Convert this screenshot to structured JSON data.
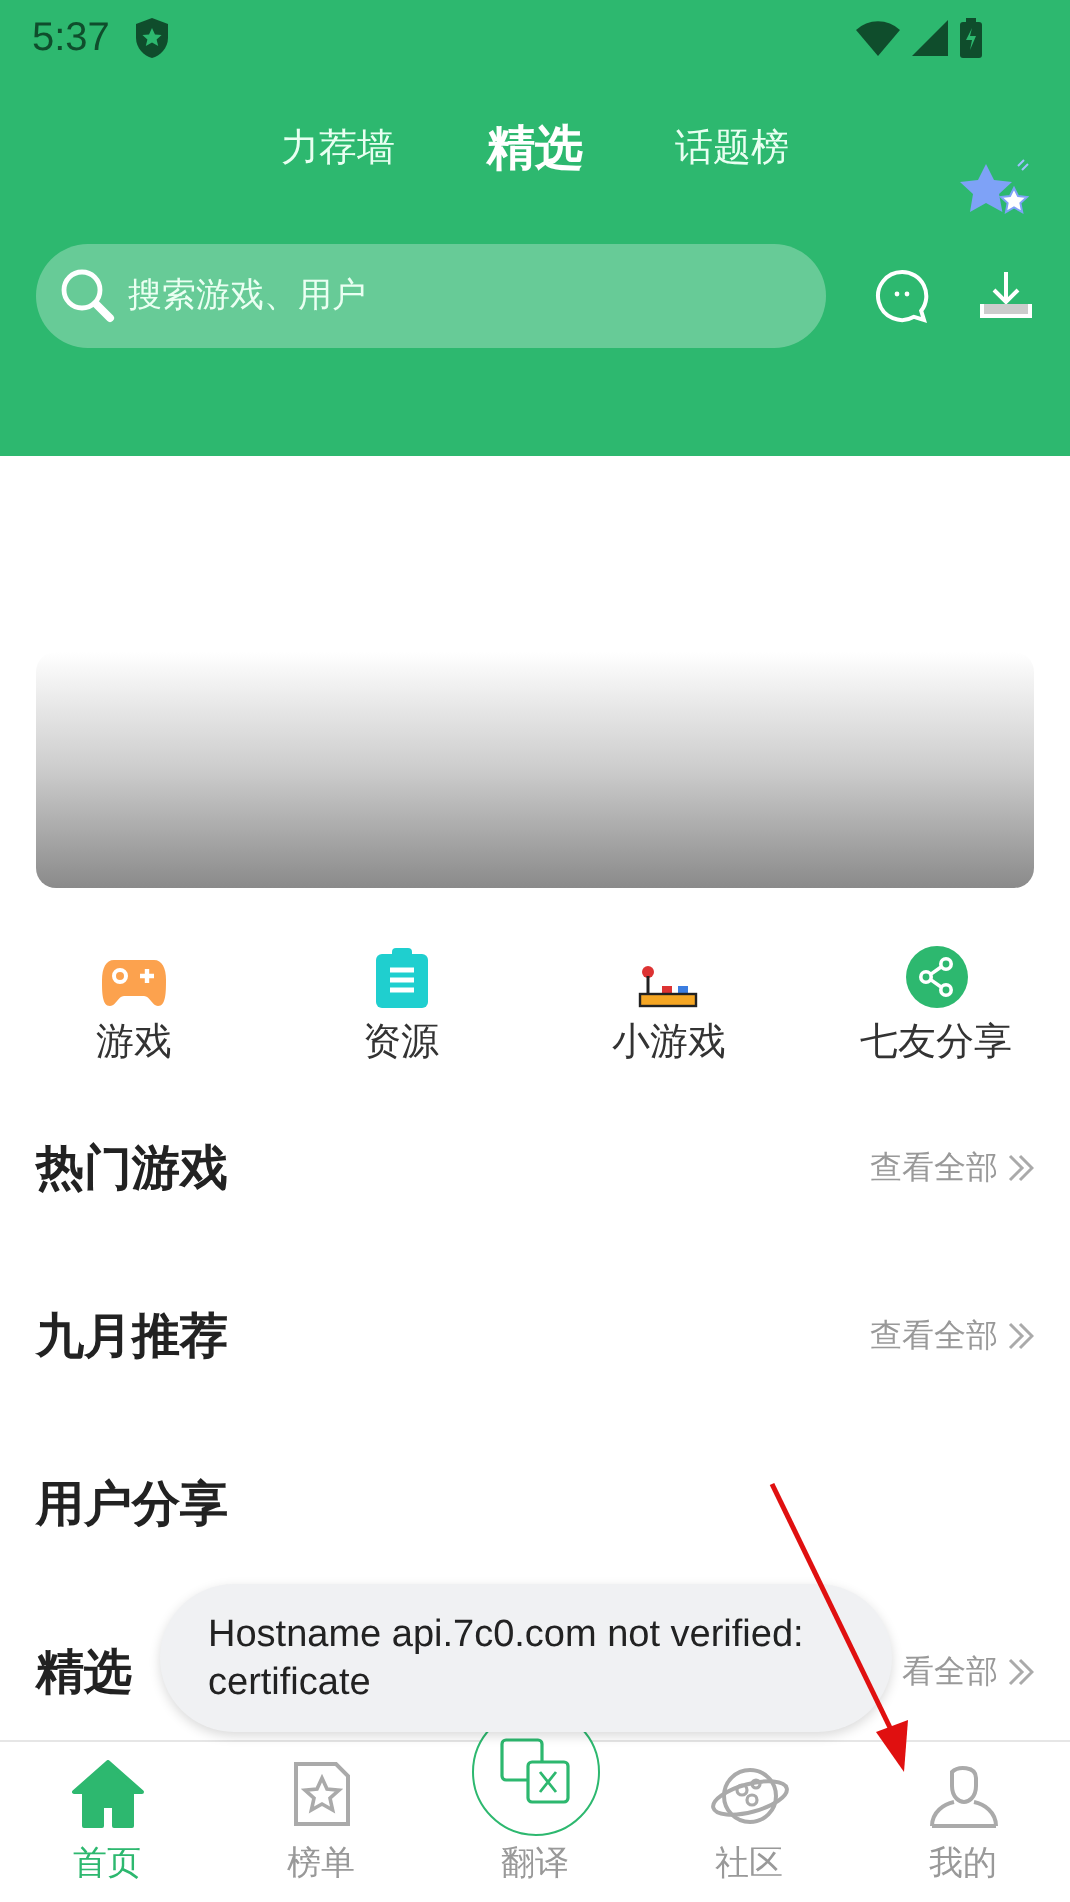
{
  "status_bar": {
    "time": "5:37"
  },
  "tabs": [
    {
      "label": "力荐墙",
      "selected": false
    },
    {
      "label": "精选",
      "selected": true
    },
    {
      "label": "话题榜",
      "selected": false
    }
  ],
  "search": {
    "placeholder": "搜索游戏、用户"
  },
  "categories": [
    {
      "label": "游戏",
      "kind": "gamepad"
    },
    {
      "label": "资源",
      "kind": "clipboard"
    },
    {
      "label": "小游戏",
      "kind": "arcade"
    },
    {
      "label": "七友分享",
      "kind": "share"
    }
  ],
  "sections": [
    {
      "title": "热门游戏",
      "more": "查看全部"
    },
    {
      "title": "九月推荐",
      "more": "查看全部"
    },
    {
      "title": "用户分享"
    },
    {
      "title": "精选",
      "more": "看全部"
    }
  ],
  "toast": {
    "message": "Hostname api.7c0.com not verified: certificate"
  },
  "bottom_nav": [
    {
      "label": "首页",
      "kind": "home",
      "selected": true
    },
    {
      "label": "榜单",
      "kind": "chart",
      "selected": false
    },
    {
      "label": "翻译",
      "kind": "translate",
      "selected": false
    },
    {
      "label": "社区",
      "kind": "planet",
      "selected": false
    },
    {
      "label": "我的",
      "kind": "profile",
      "selected": false
    }
  ]
}
